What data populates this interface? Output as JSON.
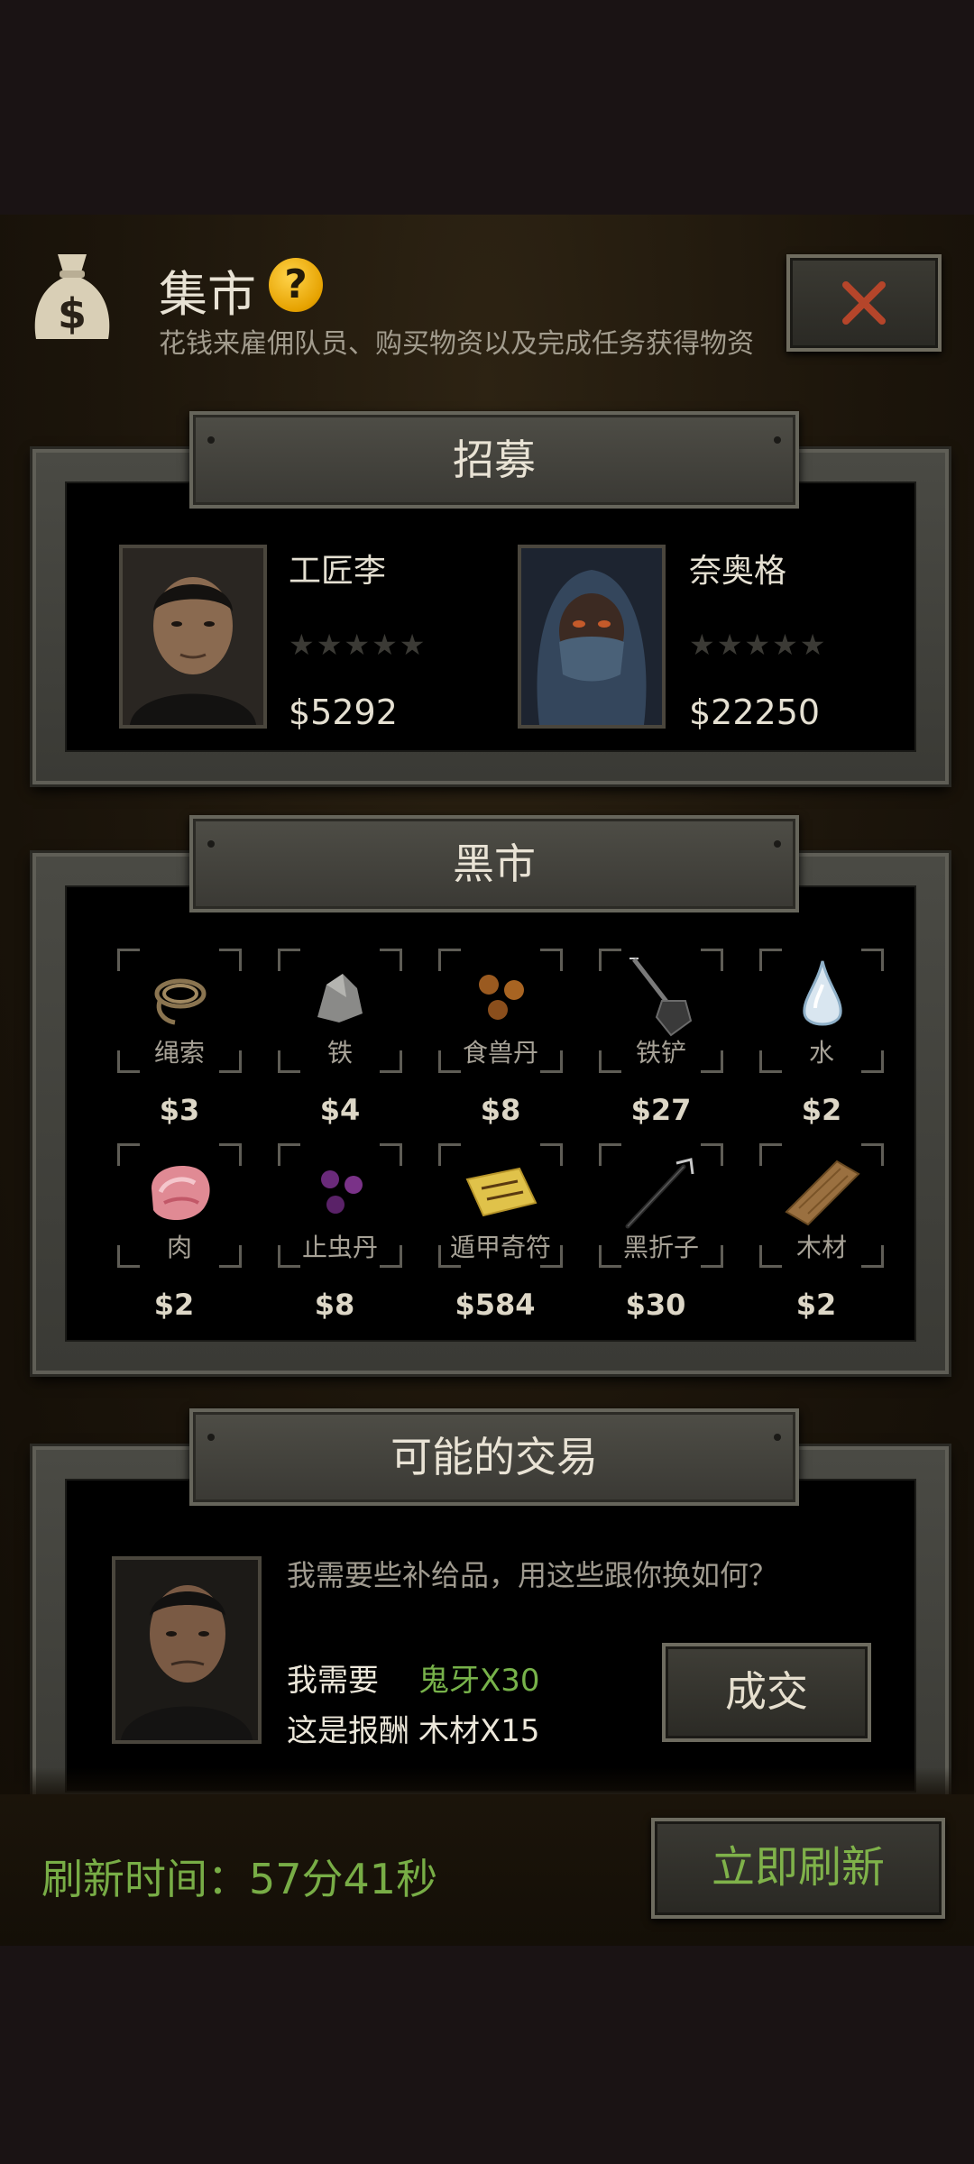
{
  "header": {
    "title": "集市",
    "help": "?",
    "subtitle": "花钱来雇佣队员、购买物资以及完成任务获得物资"
  },
  "recruit": {
    "title": "招募",
    "members": [
      {
        "name": "工匠李",
        "price": "$5292",
        "stars": "★★★★★"
      },
      {
        "name": "奈奥格",
        "price": "$22250",
        "stars": "★★★★★"
      }
    ]
  },
  "black_market": {
    "title": "黑市",
    "items": [
      {
        "name": "绳索",
        "price": "$3",
        "icon": "rope-icon"
      },
      {
        "name": "铁",
        "price": "$4",
        "icon": "iron-ore-icon"
      },
      {
        "name": "食兽丹",
        "price": "$8",
        "icon": "beast-pill-icon"
      },
      {
        "name": "铁铲",
        "price": "$27",
        "icon": "shovel-icon"
      },
      {
        "name": "水",
        "price": "$2",
        "icon": "water-drop-icon"
      },
      {
        "name": "肉",
        "price": "$2",
        "icon": "meat-icon"
      },
      {
        "name": "止虫丹",
        "price": "$8",
        "icon": "insect-pill-icon"
      },
      {
        "name": "遁甲奇符",
        "price": "$584",
        "icon": "talisman-icon"
      },
      {
        "name": "黑折子",
        "price": "$30",
        "icon": "torch-stick-icon"
      },
      {
        "name": "木材",
        "price": "$2",
        "icon": "wood-icon"
      }
    ]
  },
  "trade": {
    "title": "可能的交易",
    "question": "我需要些补给品，用这些跟你换如何？",
    "need_label": "我需要",
    "need_value": "鬼牙X30",
    "reward_label": "这是报酬",
    "reward_value": "木材X15",
    "deal_button": "成交"
  },
  "footer": {
    "refresh_time": "刷新时间：57分41秒",
    "refresh_button": "立即刷新"
  },
  "colors": {
    "accent_green": "#77b24a",
    "help_yellow": "#f0b400",
    "close_red": "#b5452a"
  }
}
